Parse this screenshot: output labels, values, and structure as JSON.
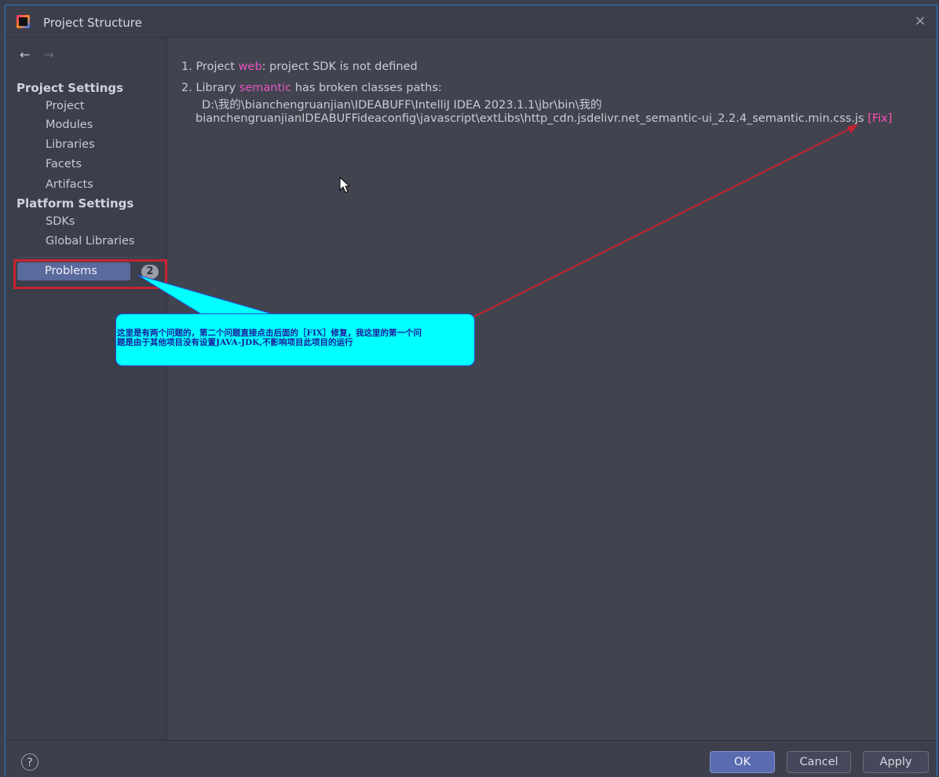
{
  "window": {
    "title": "Project Structure",
    "close_glyph": "×"
  },
  "sidebar": {
    "back_glyph": "←",
    "forward_glyph": "→",
    "sections": [
      {
        "header": "Project Settings",
        "items": [
          "Project",
          "Modules",
          "Libraries",
          "Facets",
          "Artifacts"
        ]
      },
      {
        "header": "Platform Settings",
        "items": [
          "SDKs",
          "Global Libraries"
        ]
      }
    ],
    "problems": {
      "label": "Problems",
      "count": "2"
    }
  },
  "main": {
    "problem1": {
      "prefix": "1. Project ",
      "name": "web",
      "suffix": ": project SDK is not defined"
    },
    "problem2": {
      "prefix": "2. Library ",
      "name": "semantic",
      "suffix": " has broken classes paths:",
      "path_line1": "D:\\我的\\bianchengruanjian\\IDEABUFF\\IntelliJ IDEA 2023.1.1\\jbr\\bin\\我的",
      "path_line2": "bianchengruanjianIDEABUFFideaconfig\\javascript\\extLibs\\http_cdn.jsdelivr.net_semantic-ui_2.2.4_semantic.min.css.js ",
      "fix_label": "[Fix]"
    }
  },
  "footer": {
    "help_glyph": "?",
    "ok_label": "OK",
    "cancel_label": "Cancel",
    "apply_label": "Apply"
  },
  "annotation": {
    "line1": "这里是有两个问题的，第二个问题直接点击后面的［FIX］修复，我这里的第一个问",
    "line2": "题是由于其他项目没有设置JAVA-JDK,不影响项目此项目的运行"
  },
  "colors": {
    "highlight": "#e855c5",
    "fix_link": "#ff4fb5",
    "callout_fill": "#00ffff",
    "annotation_red": "#c7232f",
    "selection": "#5b6a9c"
  }
}
